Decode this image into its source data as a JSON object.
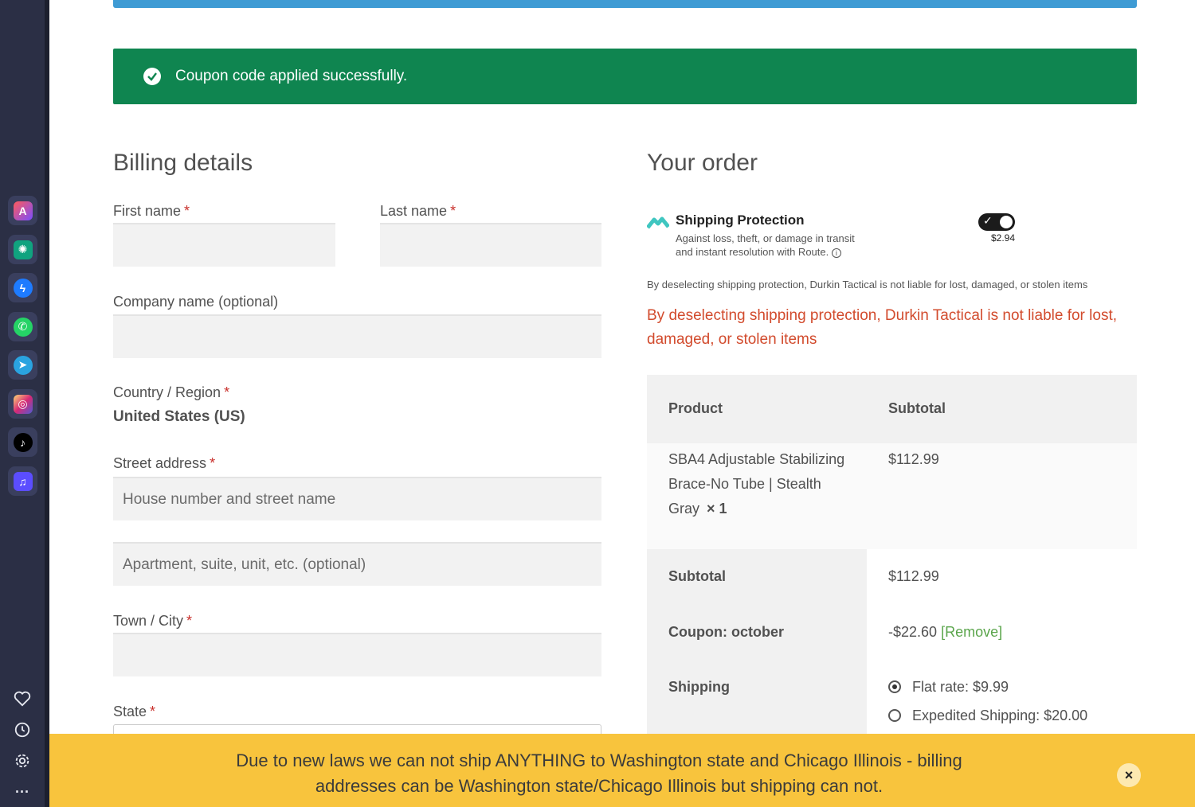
{
  "notice": {
    "text": "Coupon code applied successfully."
  },
  "billing": {
    "title": "Billing details",
    "first_name_label": "First name",
    "last_name_label": "Last name",
    "company_label": "Company name (optional)",
    "country_label": "Country / Region",
    "country_value": "United States (US)",
    "street_label": "Street address",
    "street_placeholder": "House number and street name",
    "apartment_placeholder": "Apartment, suite, unit, etc. (optional)",
    "city_label": "Town / City",
    "state_label": "State",
    "required_mark": "*"
  },
  "order": {
    "title": "Your order",
    "protection": {
      "title": "Shipping Protection",
      "desc_line1": "Against loss, theft, or damage in transit",
      "desc_line2": "and instant resolution with Route.",
      "price": "$2.94",
      "enabled": true
    },
    "small_note": "By deselecting shipping protection, Durkin Tactical is not liable for lost, damaged, or stolen items",
    "warning": "By deselecting shipping protection, Durkin Tactical is not liable for lost, damaged, or stolen items",
    "table": {
      "col_product": "Product",
      "col_subtotal": "Subtotal",
      "item_line1": "SBA4 Adjustable Stabilizing",
      "item_line2": "Brace-No Tube | Stealth",
      "item_line3": "Gray",
      "item_qty": "× 1",
      "item_price": "$112.99",
      "subtotal_label": "Subtotal",
      "subtotal_value": "$112.99",
      "coupon_label": "Coupon: october",
      "coupon_value": "-$22.60",
      "coupon_remove": "[Remove]",
      "shipping_label": "Shipping",
      "shipping_options": [
        {
          "label": "Flat rate: $9.99",
          "selected": true
        },
        {
          "label": "Expedited Shipping: $20.00",
          "selected": false
        }
      ]
    }
  },
  "banner": {
    "line1": "Due to new laws we can not ship ANYTHING to Washington state and Chicago Illinois - billing",
    "line2": "addresses can be Washington state/Chicago Illinois but shipping can not.",
    "close": "×"
  },
  "sidebar": {
    "apps": [
      "aria-icon",
      "chatgpt-icon",
      "messenger-icon",
      "whatsapp-icon",
      "telegram-icon",
      "instagram-icon",
      "tiktok-icon",
      "player-icon"
    ],
    "more": "···"
  }
}
